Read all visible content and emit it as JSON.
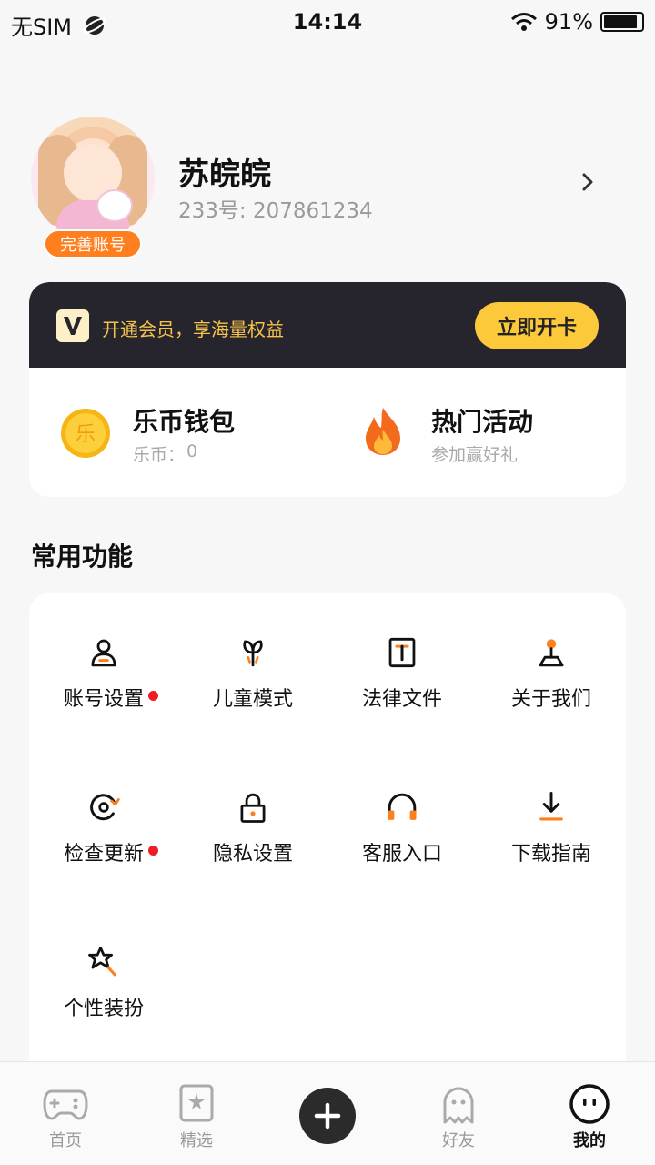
{
  "status_bar": {
    "carrier": "无SIM",
    "time": "14:14",
    "battery_text": "91%",
    "battery_level": 0.91
  },
  "profile": {
    "badge": "完善账号",
    "name": "苏皖皖",
    "id_label": "233号: 207861234"
  },
  "vip": {
    "text": "开通会员，享海量权益",
    "button": "立即开卡",
    "accent": "#fcc93a"
  },
  "wallet": {
    "title": "乐币钱包",
    "sub_label": "乐币：",
    "balance": "0",
    "icon_char": "乐"
  },
  "activity": {
    "title": "热门活动",
    "subtitle": "参加赢好礼"
  },
  "common": {
    "title": "常用功能",
    "items": [
      {
        "label": "账号设置",
        "icon": "user-icon",
        "dot": true
      },
      {
        "label": "儿童模式",
        "icon": "sprout-icon",
        "dot": false
      },
      {
        "label": "法律文件",
        "icon": "document-icon",
        "dot": false
      },
      {
        "label": "关于我们",
        "icon": "joystick-icon",
        "dot": false
      },
      {
        "label": "检查更新",
        "icon": "refresh-icon",
        "dot": true
      },
      {
        "label": "隐私设置",
        "icon": "lock-icon",
        "dot": false
      },
      {
        "label": "客服入口",
        "icon": "headphones-icon",
        "dot": false
      },
      {
        "label": "下载指南",
        "icon": "download-icon",
        "dot": false
      },
      {
        "label": "个性装扮",
        "icon": "star-wand-icon",
        "dot": false
      }
    ]
  },
  "nav": {
    "items": [
      {
        "label": "首页",
        "icon": "gamepad-icon",
        "active": false
      },
      {
        "label": "精选",
        "icon": "featured-icon",
        "active": false
      },
      {
        "label": "",
        "icon": "plus-icon",
        "active": false
      },
      {
        "label": "好友",
        "icon": "ghost-icon",
        "active": false
      },
      {
        "label": "我的",
        "icon": "face-icon",
        "active": true
      }
    ]
  },
  "colors": {
    "accent_orange": "#ff7f1f",
    "vip_dark": "#26252e",
    "vip_gold": "#f6c34a",
    "notify_red": "#ee1c25"
  }
}
